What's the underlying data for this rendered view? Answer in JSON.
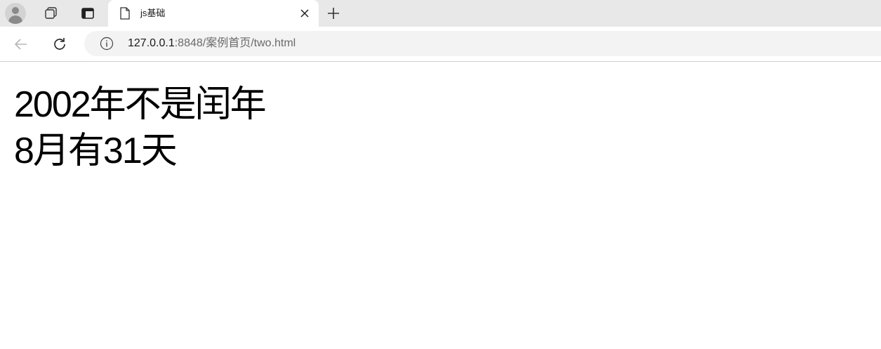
{
  "browser": {
    "tab": {
      "title": "js基础",
      "close_icon": "close-icon",
      "page_icon": "document-icon"
    },
    "new_tab_icon": "plus-icon",
    "address": {
      "host": "127.0.0.1",
      "rest": ":8848/案例首页/two.html",
      "info_icon": "info-icon"
    }
  },
  "page": {
    "lines": [
      "2002年不是闰年",
      "8月有31天"
    ]
  }
}
